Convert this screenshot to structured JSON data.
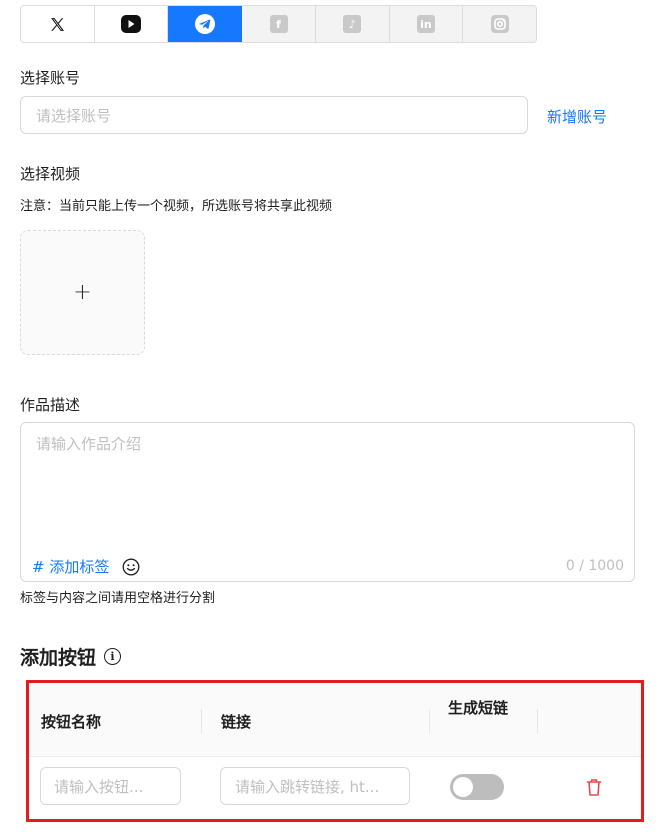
{
  "tabs": [
    {
      "icon": "x-icon",
      "label": "X",
      "active": false
    },
    {
      "icon": "youtube-icon",
      "label": "YouTube",
      "active": false
    },
    {
      "icon": "telegram-icon",
      "label": "Telegram",
      "active": true
    },
    {
      "icon": "facebook-icon",
      "label": "f",
      "active": false
    },
    {
      "icon": "tiktok-icon",
      "label": "♪",
      "active": false
    },
    {
      "icon": "linkedin-icon",
      "label": "in",
      "active": false
    },
    {
      "icon": "instagram-icon",
      "label": "Instagram",
      "active": false
    }
  ],
  "account": {
    "label": "选择账号",
    "placeholder": "请选择账号",
    "add_label": "新增账号"
  },
  "video": {
    "label": "选择视频",
    "note": "注意：当前只能上传一个视频，所选账号将共享此视频",
    "upload_symbol": "+"
  },
  "description": {
    "label": "作品描述",
    "placeholder": "请输入作品介绍",
    "add_tag": "# 添加标签",
    "emoji_icon": "smiley-icon",
    "counter": "0 / 1000",
    "hint": "标签与内容之间请用空格进行分割"
  },
  "buttons_section": {
    "title": "添加按钮",
    "info_symbol": "i",
    "columns": [
      "按钮名称",
      "链接",
      "生成短链"
    ],
    "row": {
      "name_placeholder": "请输入按钮...",
      "link_placeholder": "请输入跳转链接, ht...",
      "short_link_enabled": false
    }
  },
  "colors": {
    "accent": "#1677ff",
    "highlight_border": "#e51c1c",
    "delete_icon": "#e5484d"
  }
}
